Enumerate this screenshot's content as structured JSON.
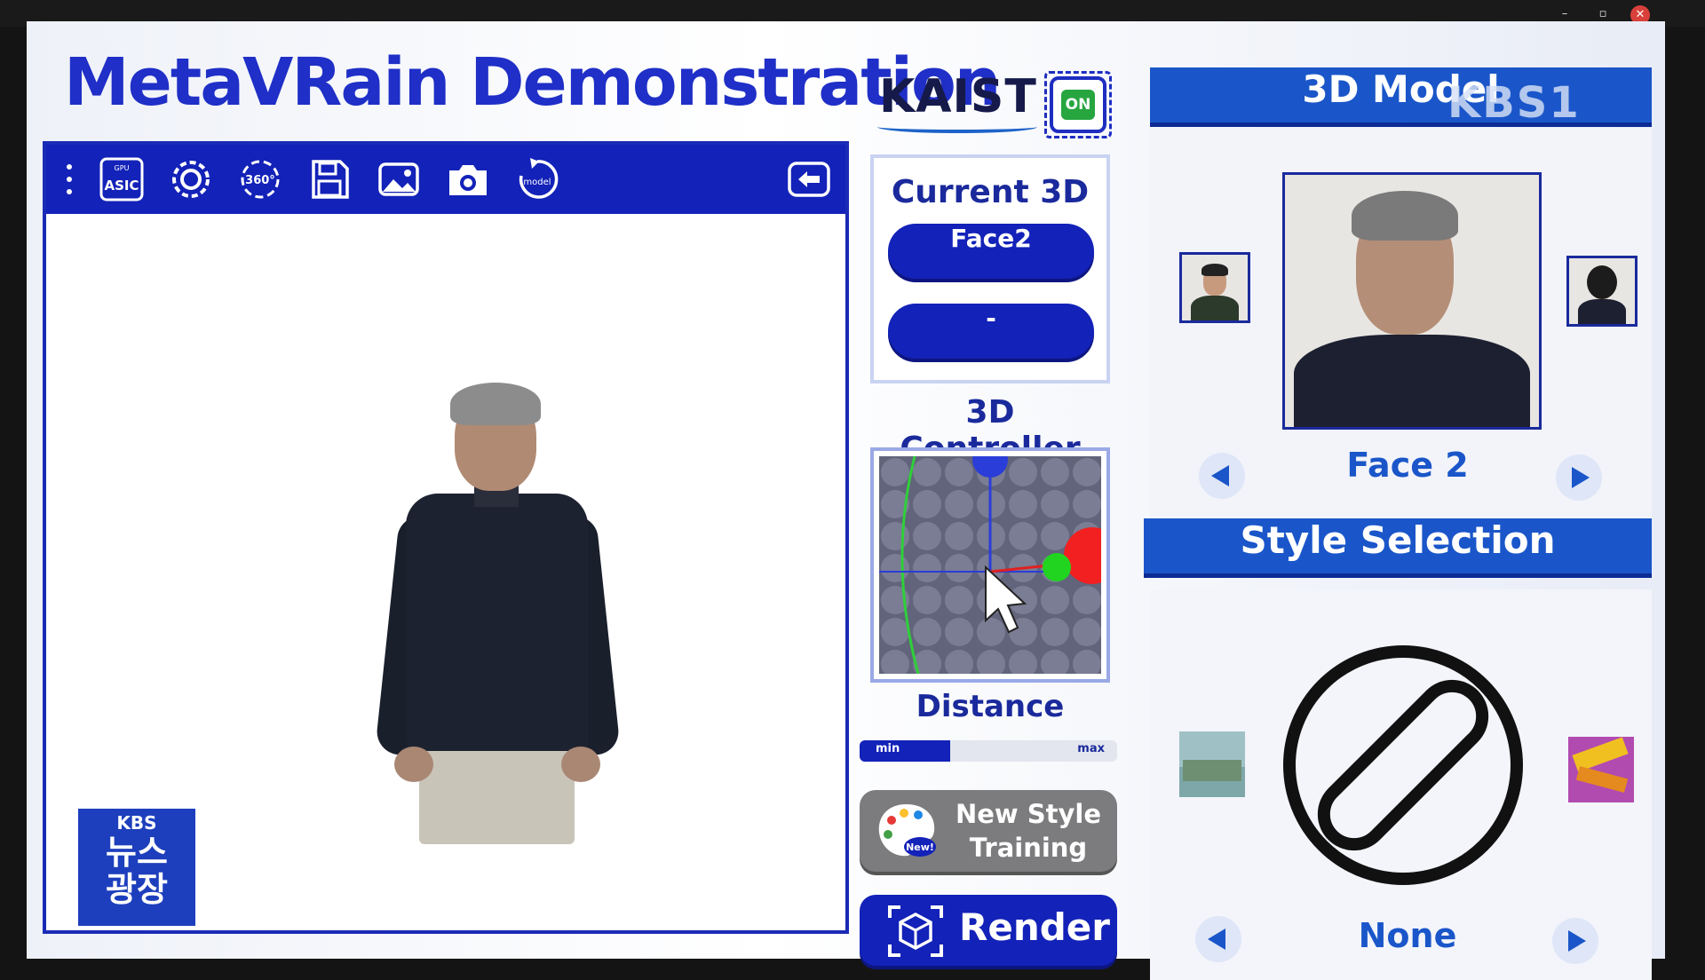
{
  "app": {
    "title": "MetaVRain Demonstration",
    "org_logo": "KAIST",
    "chip_status": "ON"
  },
  "window_controls": {
    "minimize": "–",
    "restore": "▫",
    "close": "✕"
  },
  "toolbar": {
    "menu_icon": "more-vertical-icon",
    "buttons": [
      {
        "name": "gpu-asic-toggle",
        "icon": "gpu-asic-icon",
        "label_top": "GPU",
        "label": "ASIC"
      },
      {
        "name": "settings",
        "icon": "settings-icon"
      },
      {
        "name": "rotate-360",
        "icon": "rotate-360-icon",
        "label": "360°"
      },
      {
        "name": "save",
        "icon": "save-icon"
      },
      {
        "name": "image",
        "icon": "image-icon"
      },
      {
        "name": "camera",
        "icon": "camera-icon"
      },
      {
        "name": "reset-model",
        "icon": "reset-model-icon",
        "label": "model"
      },
      {
        "name": "back",
        "icon": "back-arrow-icon"
      }
    ]
  },
  "current_3d": {
    "title": "Current 3D",
    "slot1": "Face2",
    "slot2": "-"
  },
  "controller": {
    "title": "3D Controller"
  },
  "distance": {
    "title": "Distance",
    "min_label": "min",
    "max_label": "max",
    "value": 0.35
  },
  "new_style": {
    "label_line1": "New Style",
    "label_line2": "Training",
    "badge": "New!"
  },
  "render": {
    "label": "Render"
  },
  "model_panel": {
    "title": "3D Model",
    "selected": "Face 2"
  },
  "style_panel": {
    "title": "Style Selection",
    "selected": "None"
  },
  "overlay": {
    "broadcaster": "KBS",
    "program_line1": "뉴스",
    "program_line2": "광장",
    "watermark": "KBS1"
  },
  "colors": {
    "primary": "#1322b8",
    "accent_blue": "#1a56c9",
    "title_blue": "#1f2fc7",
    "on_green": "#27a640"
  }
}
